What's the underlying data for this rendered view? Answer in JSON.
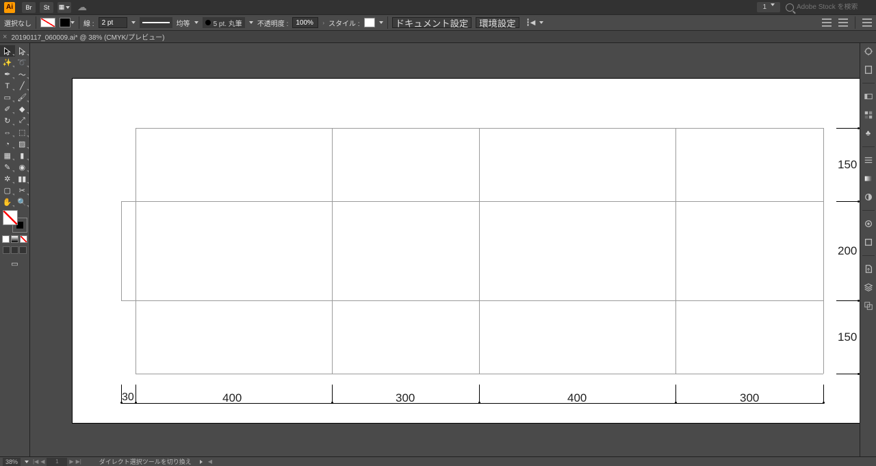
{
  "menubar": {
    "logo": "Ai",
    "icons": [
      "Br",
      "St"
    ],
    "layout_value": "1",
    "search_placeholder": "Adobe Stock を検索"
  },
  "controlbar": {
    "no_selection": "選択なし",
    "stroke_label": "線 :",
    "stroke_value": "2 pt",
    "dash_label": "均等",
    "brush_value": "5 pt. 丸筆",
    "opacity_label": "不透明度 :",
    "opacity_value": "100%",
    "style_label": "スタイル :",
    "doc_setup_btn": "ドキュメント設定",
    "prefs_btn": "環境設定"
  },
  "tab": {
    "title": "20190117_060009.ai* @ 38% (CMYK/プレビュー)"
  },
  "canvas": {
    "dims": {
      "row_heights": [
        "150",
        "200",
        "150"
      ],
      "col_offset": "30",
      "col_widths": [
        "400",
        "300",
        "400",
        "300"
      ]
    }
  },
  "statusbar": {
    "zoom": "38%",
    "artboard": "1",
    "hint": "ダイレクト選択ツールを切り換え"
  }
}
